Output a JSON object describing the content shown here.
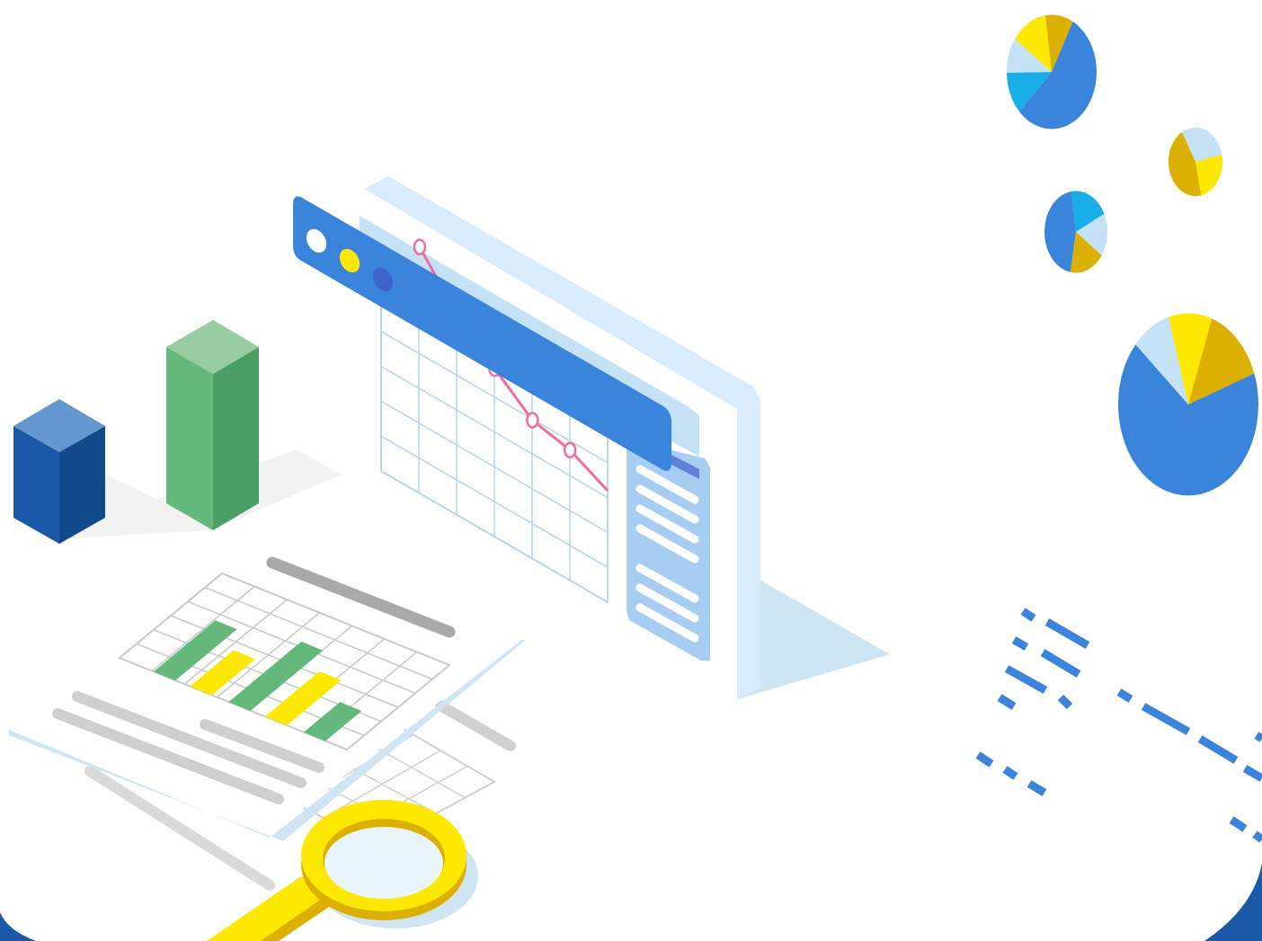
{
  "scene": {
    "description_free": true,
    "colors": {
      "blue_dark": "#1b58a8",
      "blue_darker": "#134a8c",
      "blue_top": "#6496d0",
      "blue_primary": "#3a84db",
      "blue_pale": "#d9ecfb",
      "blue_light": "#c4e1f6",
      "blue_mid": "#a8cdf2",
      "cyan": "#1aaee8",
      "green_front": "#64b87c",
      "green_side": "#4a9e66",
      "green_top": "#98cca3",
      "yellow": "#fce800",
      "yellow_dark": "#dcb000",
      "pink": "#f36a9f",
      "gray_bar": "#a9a9a9",
      "gray_light": "#cfcfcf",
      "grid_line": "#c8c8c8",
      "indigo_dot": "#3d62cc"
    },
    "window_dots": [
      "white-dot",
      "yellow-dot",
      "indigo-dot"
    ],
    "line_series": [
      {
        "index": 0,
        "level": 0.0
      },
      {
        "index": 1,
        "level": 0.34
      },
      {
        "index": 2,
        "level": 0.58
      },
      {
        "index": 3,
        "level": 0.8
      },
      {
        "index": 4,
        "level": 0.86
      },
      {
        "index": 5,
        "level": 1.0
      }
    ],
    "sheet_bars": {
      "green_levels": [
        0.85,
        1.0,
        0.5
      ],
      "yellow_levels": [
        0.6,
        0.75
      ]
    },
    "pies": [
      {
        "name": "pie-chart-top",
        "slices": [
          0.55,
          0.12,
          0.1,
          0.13,
          0.1
        ]
      },
      {
        "name": "pie-chart-small",
        "slices": [
          0.3,
          0.25,
          0.45
        ]
      },
      {
        "name": "pie-chart-middle",
        "slices": [
          0.45,
          0.2,
          0.17,
          0.18
        ]
      },
      {
        "name": "pie-chart-large",
        "slices": [
          0.67,
          0.09,
          0.1,
          0.14
        ]
      }
    ],
    "icons": [
      "bar-column-icon",
      "window-icon",
      "spreadsheet-icon",
      "magnifier-icon",
      "pie-chart-icon",
      "dash-pattern-icon"
    ]
  }
}
